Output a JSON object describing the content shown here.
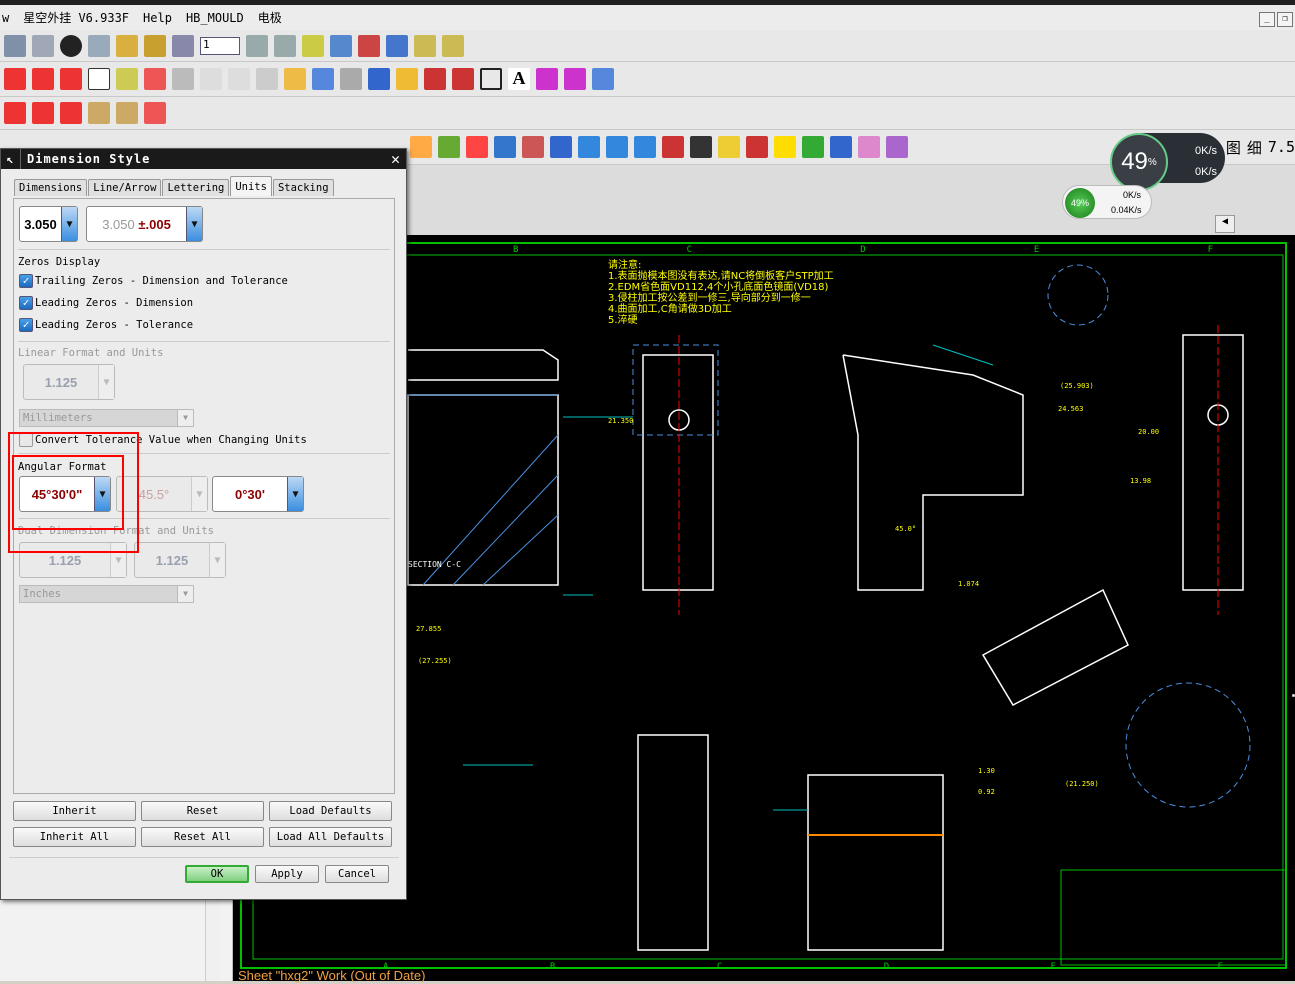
{
  "menubar": {
    "items": [
      "w",
      "星空外挂 V6.933F",
      "Help",
      "HB_MOULD",
      "电极"
    ]
  },
  "network_widget": {
    "cpu_large": "49",
    "cpu_unit": "%",
    "up_large": "0K/s",
    "down_large": "0K/s",
    "cpu_small": "49%",
    "up_small": "0K/s",
    "down_small": "0.04K/s"
  },
  "toolbar": {
    "layer_value": "1",
    "labels": [
      "图",
      "细",
      "7.5"
    ]
  },
  "dialog": {
    "title": "Dimension Style",
    "tabs": [
      "Dimensions",
      "Line/Arrow",
      "Lettering",
      "Units",
      "Stacking"
    ],
    "active_tab": "Units",
    "precision_value": "3.050",
    "tolerance_value": "3.050",
    "tolerance_suffix": "±.005",
    "zeros_title": "Zeros Display",
    "checkboxes": [
      {
        "label": "Trailing Zeros - Dimension and Tolerance",
        "checked": true
      },
      {
        "label": "Leading Zeros - Dimension",
        "checked": true
      },
      {
        "label": "Leading Zeros - Tolerance",
        "checked": true
      }
    ],
    "linear_title": "Linear Format and Units",
    "linear_value": "1.125",
    "linear_units": "Millimeters",
    "convert_label": "Convert Tolerance Value when Changing Units",
    "convert_checked": false,
    "angular_title": "Angular Format",
    "angular_format": "45°30'0\"",
    "angular_decimal": "45.5°",
    "angular_tolerance": "0°30'",
    "dual_title": "Dual Dimension Format and Units",
    "dual_value1": "1.125",
    "dual_value2": "1.125",
    "dual_units": "Inches",
    "buttons": {
      "inherit": "Inherit",
      "reset": "Reset",
      "load_defaults": "Load Defaults",
      "inherit_all": "Inherit All",
      "reset_all": "Reset All",
      "load_all_defaults": "Load All Defaults",
      "ok": "OK",
      "apply": "Apply",
      "cancel": "Cancel"
    }
  },
  "drawing": {
    "notes": [
      "请注意:",
      "1.表面抛模本图没有表达,请NC将倒板客户STP加工",
      "2.EDM省色面VD112,4个小孔底面色镜面(VD18)",
      "3.侵柱加工按公差到一修三,导向部分到一修一",
      "4.曲面加工,C角请做3D加工",
      "5.淬硬"
    ],
    "zone_labels": [
      "A",
      "B",
      "C",
      "D",
      "E",
      "F"
    ],
    "section_label": "SECTION C-C",
    "dims": [
      "21.350",
      "20.00",
      "13.98",
      "(27.255)",
      "27.855",
      "1.30",
      "0.92",
      "1.074",
      "45.0°",
      "(25.903)",
      "24.563",
      "(21.250)"
    ]
  },
  "status": {
    "text": "Sheet \"hxg2\" Work (Out of Date)"
  },
  "colors": {
    "cad_bg": "#000000",
    "border": "#00c000",
    "dims": "#ffff00",
    "geometry": "#ffffff",
    "highlight": "#ff0000",
    "status": "#f0a040"
  }
}
